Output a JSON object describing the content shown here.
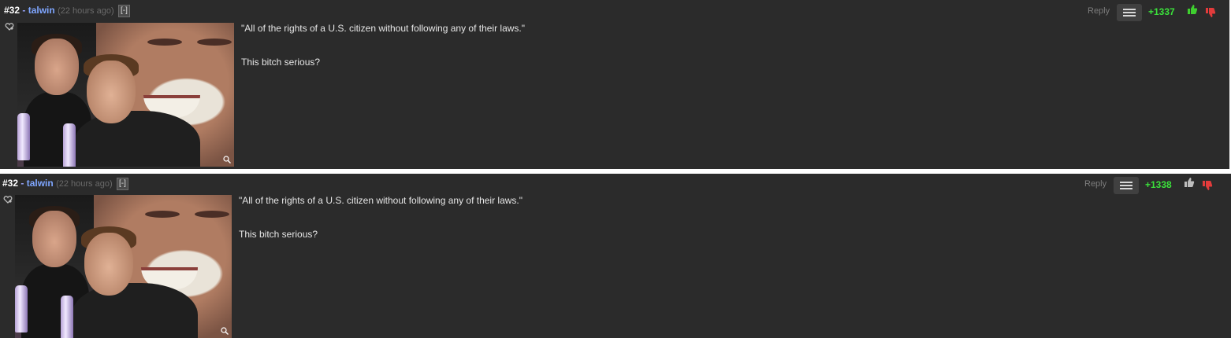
{
  "comments": [
    {
      "number": "#32",
      "separator": "-",
      "username": "talwin",
      "time": "(22 hours ago)",
      "collapse_label": "[-]",
      "reply_label": "Reply",
      "score": "+1337",
      "thumb_up_color": "#3fcf2f",
      "text_lines": [
        "\"All of the rights of a U.S. citizen without following any of their laws.\"",
        "This bitch serious?"
      ]
    },
    {
      "number": "#32",
      "separator": "-",
      "username": "talwin",
      "time": "(22 hours ago)",
      "collapse_label": "[-]",
      "reply_label": "Reply",
      "score": "+1338",
      "thumb_up_color": "#bdbdbd",
      "text_lines": [
        "\"All of the rights of a U.S. citizen without following any of their laws.\"",
        "This bitch serious?"
      ]
    }
  ],
  "colors": {
    "background": "#2b2b2b",
    "score": "#3be13b",
    "username": "#7fa6ff",
    "thumb_down": "#e23b3b"
  },
  "icons": [
    "favorite-icon",
    "zoom-icon",
    "menu-icon",
    "thumb-up-icon",
    "thumb-down-icon"
  ]
}
